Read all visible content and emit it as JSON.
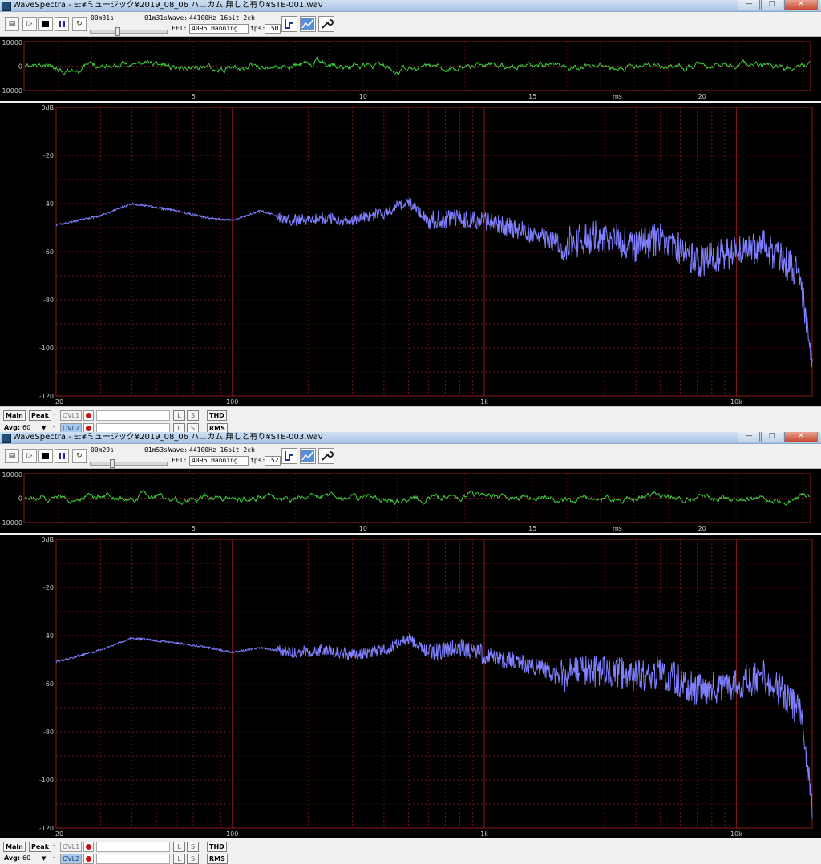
{
  "colors": {
    "wave_trace": "#3fd23f",
    "spectrum_trace": "#8080ff",
    "grid": "#8b1a1a",
    "axis_text": "#c8c8c8",
    "background": "#000000"
  },
  "windows": [
    {
      "title": "WaveSpectra - E:¥ミュージック¥2019_08_06  ハニカム  無しと有り¥STE-001.wav",
      "buttons": {
        "minimize": "—",
        "maximize": "□",
        "close": "✕"
      },
      "toolbar": {
        "elapsed": "00m31s",
        "total": "01m31s",
        "wave_label": "Wave:",
        "wave_value": "44100Hz 16bit 2ch",
        "fft_label": "FFT:",
        "fft_value": "4096 Hanning",
        "fps_label": "fps:",
        "fps_value": "150",
        "slider_position": 0.34
      },
      "wave": {
        "y_labels": [
          "10000",
          "0",
          "-10000"
        ],
        "x_labels": [
          "5",
          "10",
          "15",
          "20"
        ],
        "x_unit": "ms"
      },
      "spectrum": {
        "y_labels": [
          "0dB",
          "-20",
          "-40",
          "-60",
          "-80",
          "-100",
          "-120"
        ],
        "x_labels": [
          "20",
          "100",
          "1k",
          "10k"
        ]
      },
      "bottom": {
        "main": "Main",
        "peak": "Peak",
        "ovl1": "OVL1",
        "ovl2": "OVL2",
        "avg_label": "Avg:",
        "avg_value": "60",
        "l": "L",
        "s": "S",
        "thd": "THD",
        "rms": "RMS",
        "dash": "-"
      }
    },
    {
      "title": "WaveSpectra - E:¥ミュージック¥2019_08_06  ハニカム  無しと有り¥STE-003.wav",
      "buttons": {
        "minimize": "—",
        "maximize": "□",
        "close": "✕"
      },
      "toolbar": {
        "elapsed": "00m29s",
        "total": "01m53s",
        "wave_label": "Wave:",
        "wave_value": "44100Hz 16bit 2ch",
        "fft_label": "FFT:",
        "fft_value": "4096 Hanning",
        "fps_label": "fps:",
        "fps_value": "152",
        "slider_position": 0.26
      },
      "wave": {
        "y_labels": [
          "10000",
          "0",
          "-10000"
        ],
        "x_labels": [
          "5",
          "10",
          "15",
          "20"
        ],
        "x_unit": "ms"
      },
      "spectrum": {
        "y_labels": [
          "0dB",
          "-20",
          "-40",
          "-60",
          "-80",
          "-100",
          "-120"
        ],
        "x_labels": [
          "20",
          "100",
          "1k",
          "10k"
        ]
      },
      "bottom": {
        "main": "Main",
        "peak": "Peak",
        "ovl1": "OVL1",
        "ovl2": "OVL2",
        "avg_label": "Avg:",
        "avg_value": "60",
        "l": "L",
        "s": "S",
        "thd": "THD",
        "rms": "RMS",
        "dash": "-"
      }
    }
  ],
  "chart_data": [
    {
      "type": "line",
      "series": [
        {
          "x": [
            20,
            30,
            40,
            60,
            80,
            100,
            130,
            170,
            230,
            300,
            400,
            500,
            600,
            800,
            1000,
            1500,
            2000,
            3000,
            4000,
            5000,
            7000,
            10000,
            13000,
            15000,
            18000,
            20000
          ],
          "y": [
            -49,
            -45,
            -40,
            -43,
            -46,
            -47,
            -43,
            -47,
            -46,
            -47,
            -44,
            -39,
            -47,
            -46,
            -47,
            -52,
            -57,
            -53,
            -58,
            -54,
            -64,
            -60,
            -58,
            -63,
            -70,
            -111
          ]
        }
      ],
      "xlim": [
        20,
        20000
      ],
      "ylim": [
        -120,
        0
      ]
    },
    {
      "type": "line",
      "series": [
        {
          "x": [
            20,
            30,
            40,
            60,
            80,
            100,
            130,
            170,
            230,
            300,
            400,
            500,
            600,
            800,
            1000,
            1500,
            2000,
            3000,
            4000,
            5000,
            7000,
            10000,
            13000,
            15000,
            18000,
            20000
          ],
          "y": [
            -51,
            -46,
            -41,
            -43,
            -45,
            -47,
            -45,
            -47,
            -46,
            -48,
            -46,
            -41,
            -47,
            -45,
            -48,
            -52,
            -57,
            -54,
            -57,
            -55,
            -63,
            -60,
            -57,
            -63,
            -72,
            -112
          ]
        }
      ],
      "xlim": [
        20,
        20000
      ],
      "ylim": [
        -120,
        0
      ]
    }
  ]
}
